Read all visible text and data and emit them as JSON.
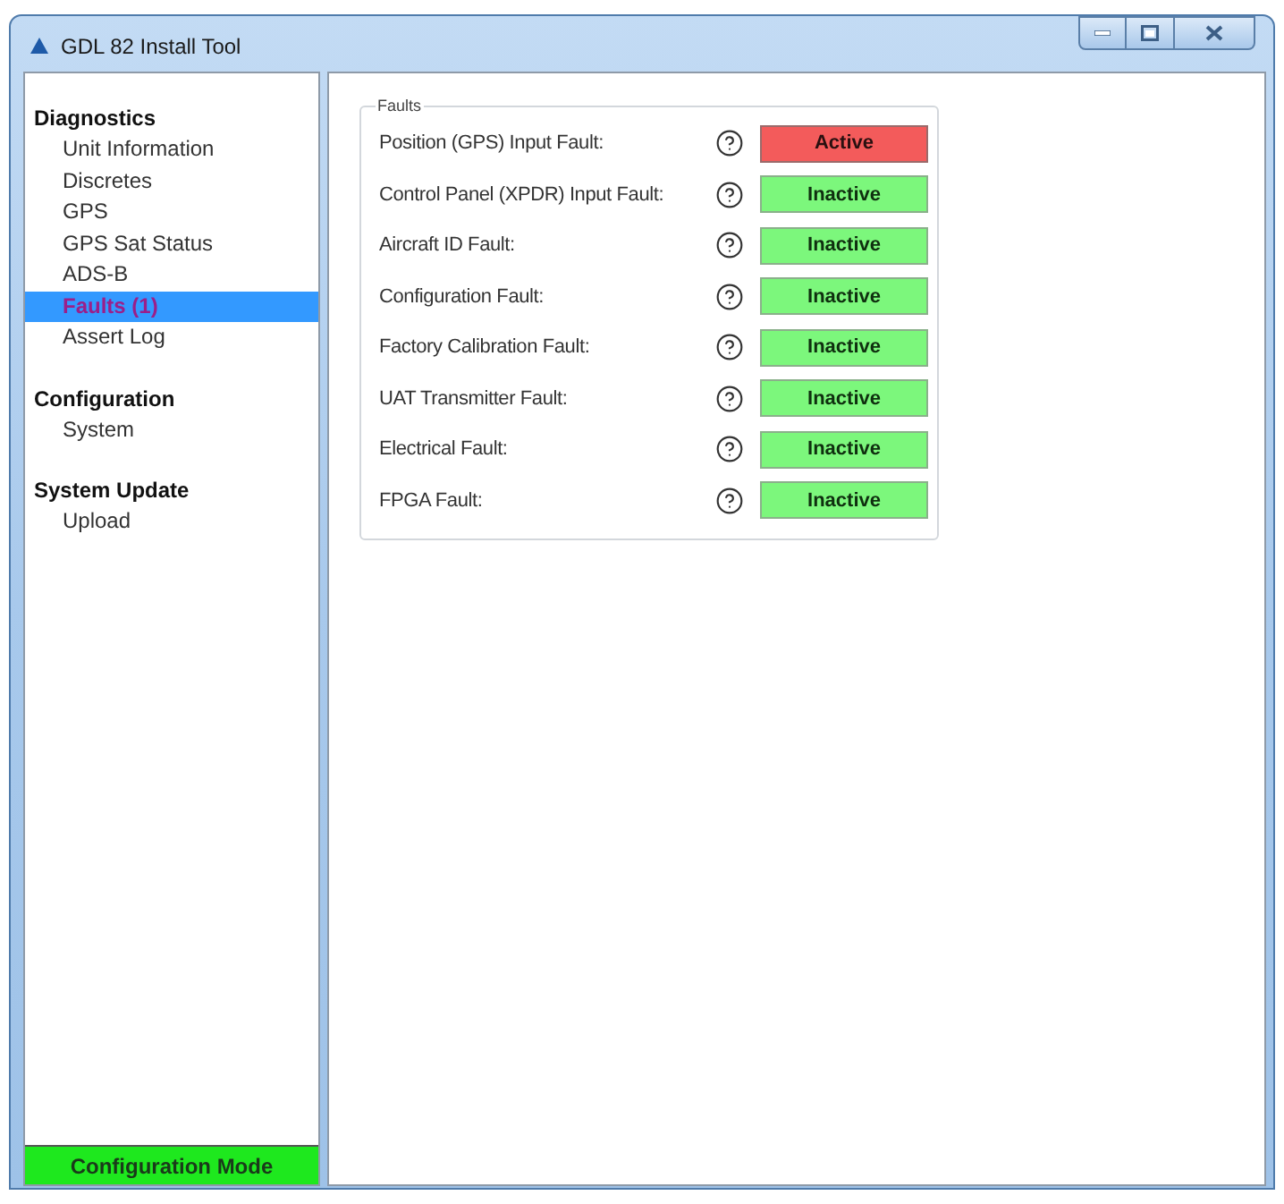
{
  "window": {
    "title": "GDL 82 Install Tool"
  },
  "sidebar": {
    "sections": [
      {
        "heading": "Diagnostics",
        "items": [
          {
            "label": "Unit Information",
            "selected": false
          },
          {
            "label": "Discretes",
            "selected": false
          },
          {
            "label": "GPS",
            "selected": false
          },
          {
            "label": "GPS Sat Status",
            "selected": false
          },
          {
            "label": "ADS-B",
            "selected": false
          },
          {
            "label": "Faults (1)",
            "selected": true
          },
          {
            "label": "Assert Log",
            "selected": false
          }
        ]
      },
      {
        "heading": "Configuration",
        "items": [
          {
            "label": "System",
            "selected": false
          }
        ]
      },
      {
        "heading": "System Update",
        "items": [
          {
            "label": "Upload",
            "selected": false
          }
        ]
      }
    ],
    "mode_badge": "Configuration Mode"
  },
  "faults_panel": {
    "title": "Faults",
    "rows": [
      {
        "label": "Position (GPS) Input Fault:",
        "status": "Active",
        "active": true
      },
      {
        "label": "Control Panel (XPDR) Input Fault:",
        "status": "Inactive",
        "active": false
      },
      {
        "label": "Aircraft ID Fault:",
        "status": "Inactive",
        "active": false
      },
      {
        "label": "Configuration Fault:",
        "status": "Inactive",
        "active": false
      },
      {
        "label": "Factory Calibration Fault:",
        "status": "Inactive",
        "active": false
      },
      {
        "label": "UAT Transmitter Fault:",
        "status": "Inactive",
        "active": false
      },
      {
        "label": "Electrical Fault:",
        "status": "Inactive",
        "active": false
      },
      {
        "label": "FPGA Fault:",
        "status": "Inactive",
        "active": false
      }
    ]
  }
}
